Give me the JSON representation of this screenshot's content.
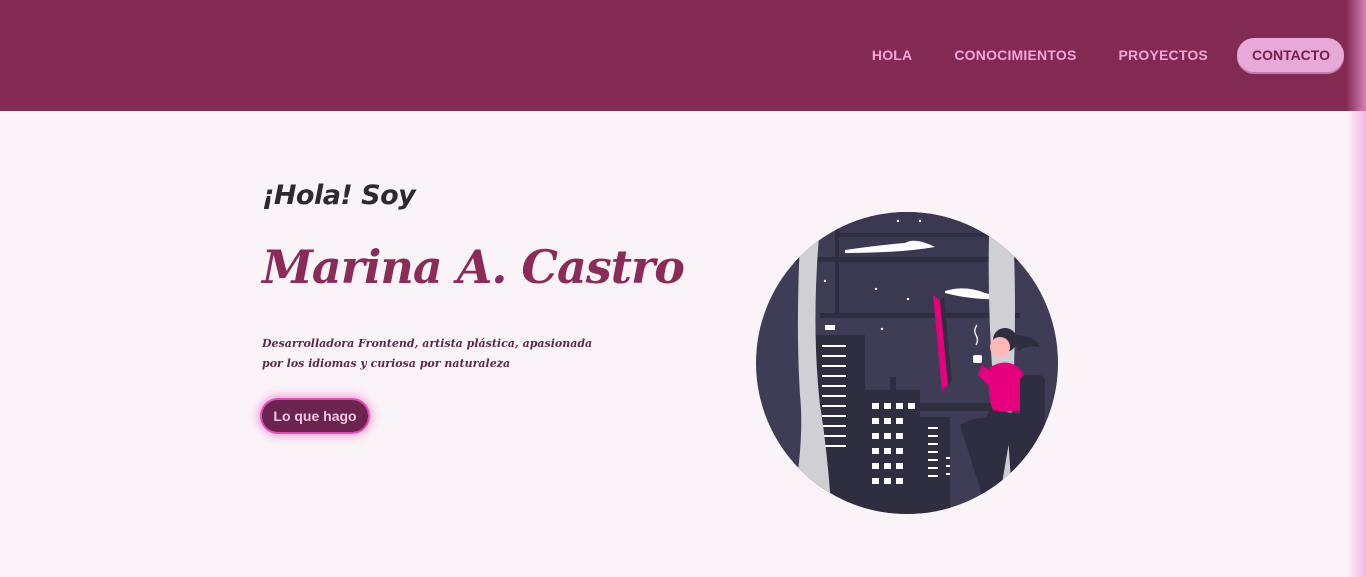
{
  "nav": {
    "items": [
      "HOLA",
      "CONOCIMIENTOS",
      "PROYECTOS"
    ],
    "contact_label": "CONTACTO"
  },
  "hero": {
    "greeting": "¡Hola! Soy",
    "name": "Marina A. Castro",
    "description": "Desarrolladora Frontend, artista plástica, apasionada por los idiomas y curiosa por naturaleza",
    "cta_label": "Lo que hago"
  },
  "colors": {
    "header_bg": "#822a52",
    "page_bg": "#faf4f8",
    "accent": "#8a2b58",
    "nav_text": "#f2a7d6",
    "contact_bg": "#e6a9d8",
    "cta_bg": "#6b2350",
    "cta_glow": "#e04fb0"
  },
  "illustration": {
    "subject": "woman-drinking-coffee-at-night-window-icon"
  }
}
